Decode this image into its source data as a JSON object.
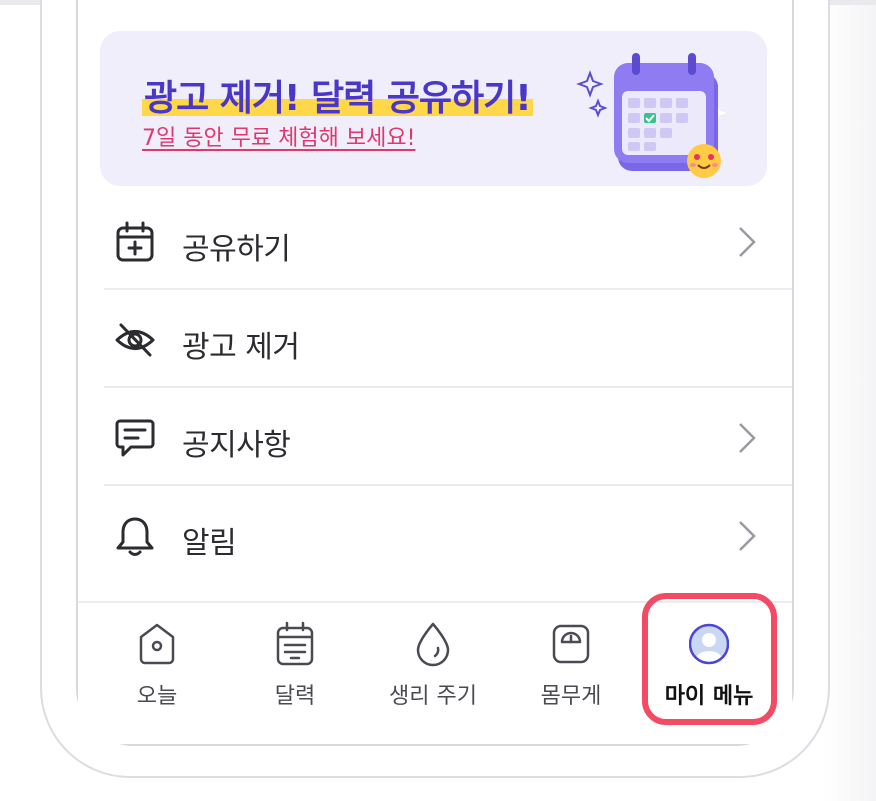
{
  "banner": {
    "title": "광고 제거! 달력 공유하기!",
    "subtitle": "7일 동안 무료 체험해 보세요!",
    "illustration": "calendar-emoji-illustration",
    "colors": {
      "background": "#f1eefc",
      "title": "#4a36c7",
      "title_highlight": "#ffd84a",
      "subtitle": "#e0386d"
    }
  },
  "menu": [
    {
      "label": "공유하기",
      "icon": "calendar-add-icon",
      "has_chevron": true
    },
    {
      "label": "광고 제거",
      "icon": "eye-off-icon",
      "has_chevron": false
    },
    {
      "label": "공지사항",
      "icon": "message-icon",
      "has_chevron": true
    },
    {
      "label": "알림",
      "icon": "bell-icon",
      "has_chevron": true
    }
  ],
  "tabbar": {
    "tabs": [
      {
        "label": "오늘",
        "icon": "home-icon",
        "active": false
      },
      {
        "label": "달력",
        "icon": "calendar-icon",
        "active": false
      },
      {
        "label": "생리 주기",
        "icon": "drop-icon",
        "active": false
      },
      {
        "label": "몸무게",
        "icon": "scale-icon",
        "active": false
      },
      {
        "label": "마이 메뉴",
        "icon": "user-avatar-icon",
        "active": true
      }
    ],
    "highlight_color": "#f24b63",
    "active_icon_color": "#4b47d6"
  }
}
